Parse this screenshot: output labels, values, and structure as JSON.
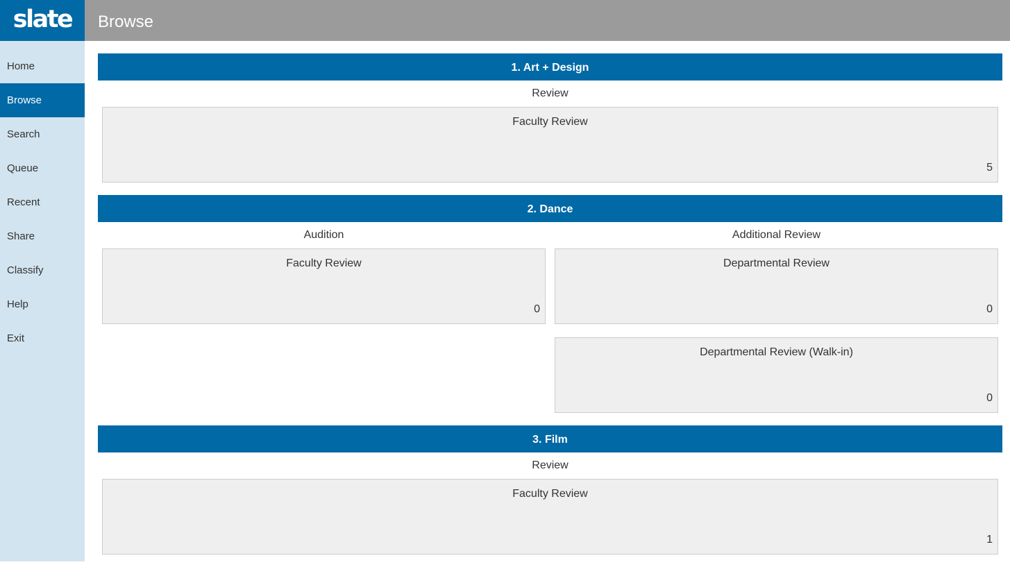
{
  "app": {
    "logo": "slate",
    "page_title": "Browse"
  },
  "sidebar": {
    "items": [
      {
        "label": "Home",
        "active": false
      },
      {
        "label": "Browse",
        "active": true
      },
      {
        "label": "Search",
        "active": false
      },
      {
        "label": "Queue",
        "active": false
      },
      {
        "label": "Recent",
        "active": false
      },
      {
        "label": "Share",
        "active": false
      },
      {
        "label": "Classify",
        "active": false
      },
      {
        "label": "Help",
        "active": false
      },
      {
        "label": "Exit",
        "active": false
      }
    ]
  },
  "colors": {
    "brand_blue": "#0069a6",
    "sidebar_bg": "#d2e4ef",
    "topbar_bg": "#9b9b9b",
    "card_bg": "#efefef"
  },
  "sections": [
    {
      "title": "1. Art + Design",
      "columns": [
        {
          "label": "Review",
          "cards": [
            {
              "title": "Faculty Review",
              "count": "5"
            }
          ]
        }
      ]
    },
    {
      "title": "2. Dance",
      "columns": [
        {
          "label": "Audition",
          "cards": [
            {
              "title": "Faculty Review",
              "count": "0"
            }
          ]
        },
        {
          "label": "Additional Review",
          "cards": [
            {
              "title": "Departmental Review",
              "count": "0"
            },
            {
              "title": "Departmental Review (Walk-in)",
              "count": "0"
            }
          ]
        }
      ]
    },
    {
      "title": "3. Film",
      "columns": [
        {
          "label": "Review",
          "cards": [
            {
              "title": "Faculty Review",
              "count": "1"
            }
          ]
        }
      ]
    }
  ]
}
